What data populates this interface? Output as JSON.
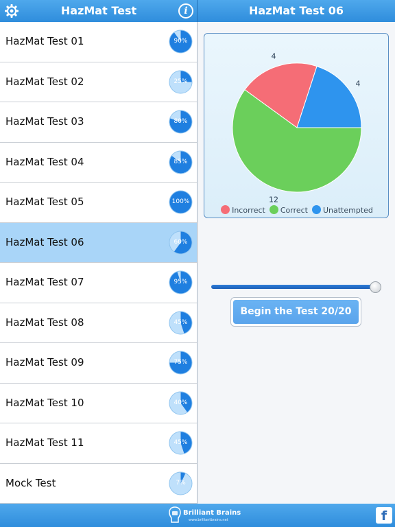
{
  "header": {
    "left_title": "HazMat Test",
    "right_title": "HazMat Test 06",
    "info_glyph": "i",
    "settings_icon": "gear-icon",
    "info_icon": "info-icon"
  },
  "colors": {
    "bar": "#3596e3",
    "progress_fill": "#1f7fe0",
    "progress_base": "#bfe0fb",
    "incorrect": "#f56d76",
    "correct": "#6bcf5b",
    "unattempted": "#2e94ee",
    "selected_row": "#a9d5f8"
  },
  "tests": [
    {
      "name": "HazMat Test 01",
      "percent": 90,
      "percent_label": "90%"
    },
    {
      "name": "HazMat Test 02",
      "percent": 25,
      "percent_label": "25%"
    },
    {
      "name": "HazMat Test 03",
      "percent": 80,
      "percent_label": "80%"
    },
    {
      "name": "HazMat Test 04",
      "percent": 85,
      "percent_label": "85%"
    },
    {
      "name": "HazMat Test 05",
      "percent": 100,
      "percent_label": "100%"
    },
    {
      "name": "HazMat Test 06",
      "percent": 60,
      "percent_label": "60%",
      "selected": true
    },
    {
      "name": "HazMat Test 07",
      "percent": 95,
      "percent_label": "95%"
    },
    {
      "name": "HazMat Test 08",
      "percent": 45,
      "percent_label": "45%"
    },
    {
      "name": "HazMat Test 09",
      "percent": 75,
      "percent_label": "75%"
    },
    {
      "name": "HazMat Test 10",
      "percent": 40,
      "percent_label": "40%"
    },
    {
      "name": "HazMat Test 11",
      "percent": 45,
      "percent_label": "45%"
    },
    {
      "name": "Mock Test",
      "percent": 7,
      "percent_label": "7%"
    }
  ],
  "chart_data": {
    "type": "pie",
    "slices": [
      {
        "name": "Incorrect",
        "value": 4,
        "label": "4",
        "color": "#f56d76"
      },
      {
        "name": "Unattempted",
        "value": 4,
        "label": "4",
        "color": "#2e94ee"
      },
      {
        "name": "Correct",
        "value": 12,
        "label": "12",
        "color": "#6bcf5b"
      }
    ],
    "legend": [
      "Incorrect",
      "Correct",
      "Unattempted"
    ],
    "legend_placement": "bottom"
  },
  "slider": {
    "value": 20,
    "max": 20
  },
  "begin_button": {
    "label": "Begin the Test",
    "count": "20/20",
    "full_label": "Begin the Test   20/20"
  },
  "footer": {
    "brand_name": "Brilliant Brains",
    "brand_url": "www.brilliantbrains.net",
    "brand_icon": "brain-icon",
    "social_icon": "facebook-icon",
    "social_glyph": "f"
  }
}
